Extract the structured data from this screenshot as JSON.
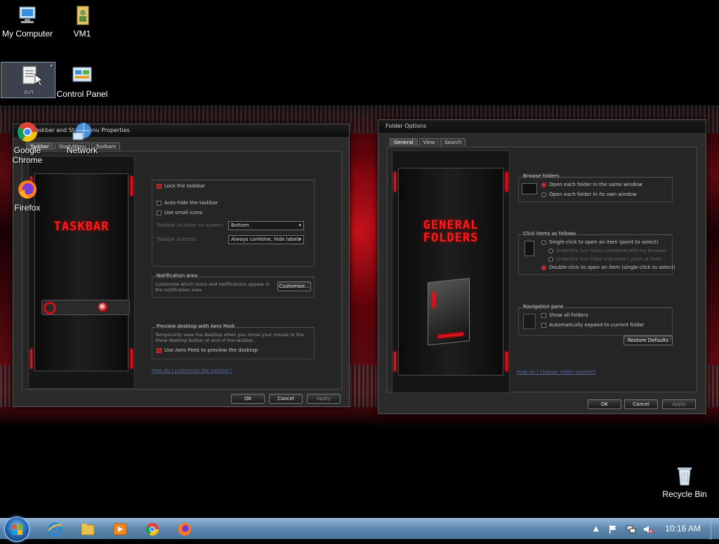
{
  "desktop_icons": [
    {
      "name": "my-computer",
      "label": "My Computer"
    },
    {
      "name": "vm1",
      "label": "VM1"
    },
    {
      "name": "xuy",
      "label": "XUY"
    },
    {
      "name": "control-panel",
      "label": "Control Panel"
    },
    {
      "name": "google-chrome",
      "label": "Google Chrome"
    },
    {
      "name": "network",
      "label": "Network"
    },
    {
      "name": "firefox",
      "label": "Firefox"
    },
    {
      "name": "recycle-bin",
      "label": "Recycle Bin"
    }
  ],
  "taskbar_window": {
    "title": "Taskbar and Start Menu Properties",
    "tabs": [
      "Taskbar",
      "Start Menu",
      "Toolbars"
    ],
    "preview_title": "TASKBAR",
    "lock_taskbar": "Lock the taskbar",
    "auto_hide": "Auto-hide the taskbar",
    "small_icons": "Use small icons",
    "location_label": "Taskbar location on screen:",
    "location_value": "Bottom",
    "buttons_label": "Taskbar buttons:",
    "buttons_value": "Always combine, hide labels",
    "notification_group": "Notification area",
    "notification_text": "Customize which icons and notifications appear in the notification area.",
    "customize_button": "Customize...",
    "aero_group": "Preview desktop with Aero Peek",
    "aero_text": "Temporarily view the desktop when you move your mouse to the Show desktop button at end of the taskbar.",
    "aero_check": "Use Aero Peek to preview the desktop",
    "help_link": "How do I customize the taskbar?",
    "ok": "OK",
    "cancel": "Cancel",
    "apply": "Apply"
  },
  "folder_window": {
    "title": "Folder Options",
    "tabs": [
      "General",
      "View",
      "Search"
    ],
    "preview_title_1": "GENERAL",
    "preview_title_2": "FOLDERS",
    "browse_group": "Browse folders",
    "browse_same": "Open each folder in the same window",
    "browse_own": "Open each folder in its own window",
    "click_group": "Click items as follows",
    "single_click": "Single-click to open an item (point to select)",
    "underline_browser": "Underline icon titles consistent with my browser",
    "underline_point": "Underline icon titles only when I point at them",
    "double_click": "Double-click to open an item (single-click to select)",
    "nav_group": "Navigation pane",
    "show_all": "Show all folders",
    "auto_expand": "Automatically expand to current folder",
    "restore_button": "Restore Defaults",
    "help_link": "How do I change folder options?",
    "ok": "OK",
    "cancel": "Cancel",
    "apply": "Apply"
  },
  "taskbar": {
    "clock": "10:16 AM"
  },
  "colors": {
    "accent": "#e0101a",
    "taskbar": "#5d86ad"
  }
}
